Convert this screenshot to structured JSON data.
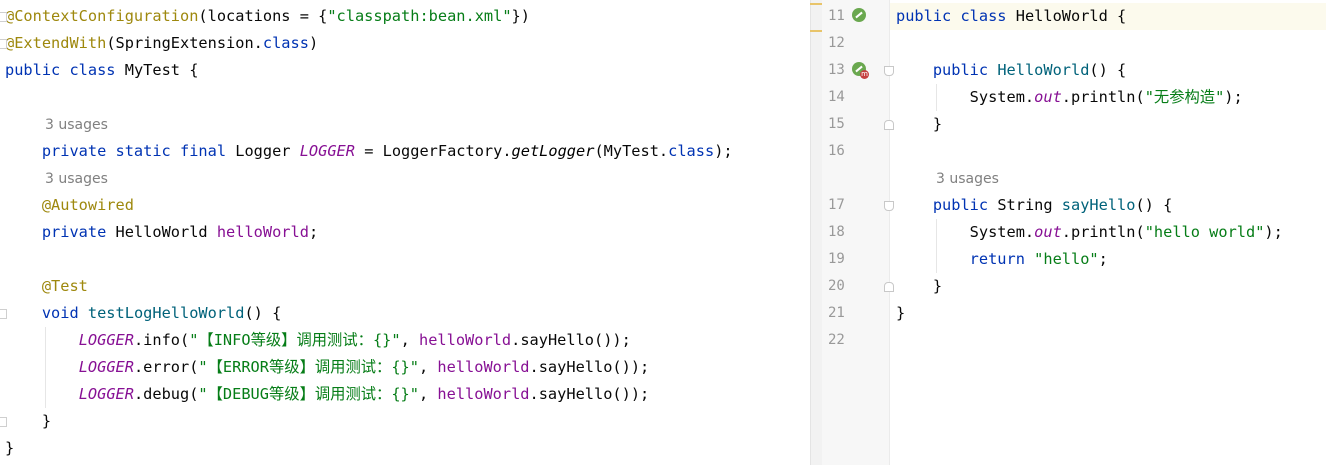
{
  "left_editor": {
    "lines": [
      {
        "tokens": [
          {
            "t": "@ContextConfiguration",
            "c": "ann"
          },
          {
            "t": "(locations = {",
            "c": "txt"
          },
          {
            "t": "\"classpath:bean.xml\"",
            "c": "str"
          },
          {
            "t": "})",
            "c": "txt"
          }
        ]
      },
      {
        "tokens": [
          {
            "t": "@ExtendWith",
            "c": "ann"
          },
          {
            "t": "(SpringExtension.",
            "c": "txt"
          },
          {
            "t": "class",
            "c": "kw"
          },
          {
            "t": ")",
            "c": "txt"
          }
        ]
      },
      {
        "tokens": [
          {
            "t": "public class ",
            "c": "kw"
          },
          {
            "t": "MyTest {",
            "c": "txt"
          }
        ]
      },
      {
        "tokens": []
      },
      {
        "hint": "3 usages"
      },
      {
        "tokens": [
          {
            "t": "    private static final ",
            "c": "kw"
          },
          {
            "t": "Logger ",
            "c": "txt"
          },
          {
            "t": "LOGGER",
            "c": "stf"
          },
          {
            "t": " = LoggerFactory.",
            "c": "txt"
          },
          {
            "t": "getLogger",
            "c": "ita"
          },
          {
            "t": "(MyTest.",
            "c": "txt"
          },
          {
            "t": "class",
            "c": "kw"
          },
          {
            "t": ");",
            "c": "txt"
          }
        ]
      },
      {
        "hint": "3 usages"
      },
      {
        "tokens": [
          {
            "t": "    @Autowired",
            "c": "ann"
          }
        ]
      },
      {
        "tokens": [
          {
            "t": "    private ",
            "c": "kw"
          },
          {
            "t": "HelloWorld ",
            "c": "txt"
          },
          {
            "t": "helloWorld",
            "c": "fld"
          },
          {
            "t": ";",
            "c": "txt"
          }
        ]
      },
      {
        "tokens": []
      },
      {
        "tokens": [
          {
            "t": "    @Test",
            "c": "ann"
          }
        ]
      },
      {
        "tokens": [
          {
            "t": "    void ",
            "c": "kw"
          },
          {
            "t": "testLogHelloWorld",
            "c": "mth"
          },
          {
            "t": "() {",
            "c": "txt"
          }
        ]
      },
      {
        "tokens": [
          {
            "t": "        ",
            "c": "txt"
          },
          {
            "t": "LOGGER",
            "c": "stf"
          },
          {
            "t": ".info(",
            "c": "txt"
          },
          {
            "t": "\"【INFO等级】调用测试：{}\"",
            "c": "str"
          },
          {
            "t": ", ",
            "c": "txt"
          },
          {
            "t": "helloWorld",
            "c": "fld"
          },
          {
            "t": ".sayHello());",
            "c": "txt"
          }
        ]
      },
      {
        "tokens": [
          {
            "t": "        ",
            "c": "txt"
          },
          {
            "t": "LOGGER",
            "c": "stf"
          },
          {
            "t": ".error(",
            "c": "txt"
          },
          {
            "t": "\"【ERROR等级】调用测试：{}\"",
            "c": "str"
          },
          {
            "t": ", ",
            "c": "txt"
          },
          {
            "t": "helloWorld",
            "c": "fld"
          },
          {
            "t": ".sayHello());",
            "c": "txt"
          }
        ]
      },
      {
        "tokens": [
          {
            "t": "        ",
            "c": "txt"
          },
          {
            "t": "LOGGER",
            "c": "stf"
          },
          {
            "t": ".debug(",
            "c": "txt"
          },
          {
            "t": "\"【DEBUG等级】调用测试：{}\"",
            "c": "str"
          },
          {
            "t": ", ",
            "c": "txt"
          },
          {
            "t": "helloWorld",
            "c": "fld"
          },
          {
            "t": ".sayHello());",
            "c": "txt"
          }
        ]
      },
      {
        "tokens": [
          {
            "t": "    }",
            "c": "txt"
          }
        ]
      },
      {
        "tokens": [
          {
            "t": "}",
            "c": "txt"
          }
        ]
      }
    ]
  },
  "right_editor": {
    "lines": [
      {
        "num": "11",
        "tokens": [
          {
            "t": "public class ",
            "c": "kw"
          },
          {
            "t": "HelloWorld {",
            "c": "txt"
          }
        ]
      },
      {
        "num": "12",
        "tokens": []
      },
      {
        "num": "13",
        "tokens": [
          {
            "t": "    public ",
            "c": "kw"
          },
          {
            "t": "HelloWorld",
            "c": "mth"
          },
          {
            "t": "() {",
            "c": "txt"
          }
        ]
      },
      {
        "num": "14",
        "tokens": [
          {
            "t": "        System.",
            "c": "txt"
          },
          {
            "t": "out",
            "c": "stf"
          },
          {
            "t": ".println(",
            "c": "txt"
          },
          {
            "t": "\"无参构造\"",
            "c": "str"
          },
          {
            "t": ");",
            "c": "txt"
          }
        ]
      },
      {
        "num": "15",
        "tokens": [
          {
            "t": "    }",
            "c": "txt"
          }
        ]
      },
      {
        "num": "16",
        "tokens": []
      },
      {
        "num": "",
        "hint": "3 usages"
      },
      {
        "num": "17",
        "tokens": [
          {
            "t": "    public ",
            "c": "kw"
          },
          {
            "t": "String ",
            "c": "txt"
          },
          {
            "t": "sayHello",
            "c": "mth"
          },
          {
            "t": "() {",
            "c": "txt"
          }
        ]
      },
      {
        "num": "18",
        "tokens": [
          {
            "t": "        System.",
            "c": "txt"
          },
          {
            "t": "out",
            "c": "stf"
          },
          {
            "t": ".println(",
            "c": "txt"
          },
          {
            "t": "\"hello world\"",
            "c": "str"
          },
          {
            "t": ");",
            "c": "txt"
          }
        ]
      },
      {
        "num": "19",
        "tokens": [
          {
            "t": "        return ",
            "c": "kw"
          },
          {
            "t": "\"hello\"",
            "c": "str"
          },
          {
            "t": ";",
            "c": "txt"
          }
        ]
      },
      {
        "num": "20",
        "tokens": [
          {
            "t": "    }",
            "c": "txt"
          }
        ]
      },
      {
        "num": "21",
        "tokens": [
          {
            "t": "}",
            "c": "txt"
          }
        ]
      },
      {
        "num": "22",
        "tokens": []
      }
    ]
  },
  "colors": {
    "keyword": "#0033b3",
    "annotation": "#9e880d",
    "string": "#067d17",
    "field": "#871094",
    "method": "#00627a",
    "bean_icon": "#6aa84f",
    "gutter_bg": "#f7f7f7"
  },
  "icons": {
    "bean_line_11": "spring-bean-icon",
    "bean_line_13": "spring-bean-method-icon"
  }
}
